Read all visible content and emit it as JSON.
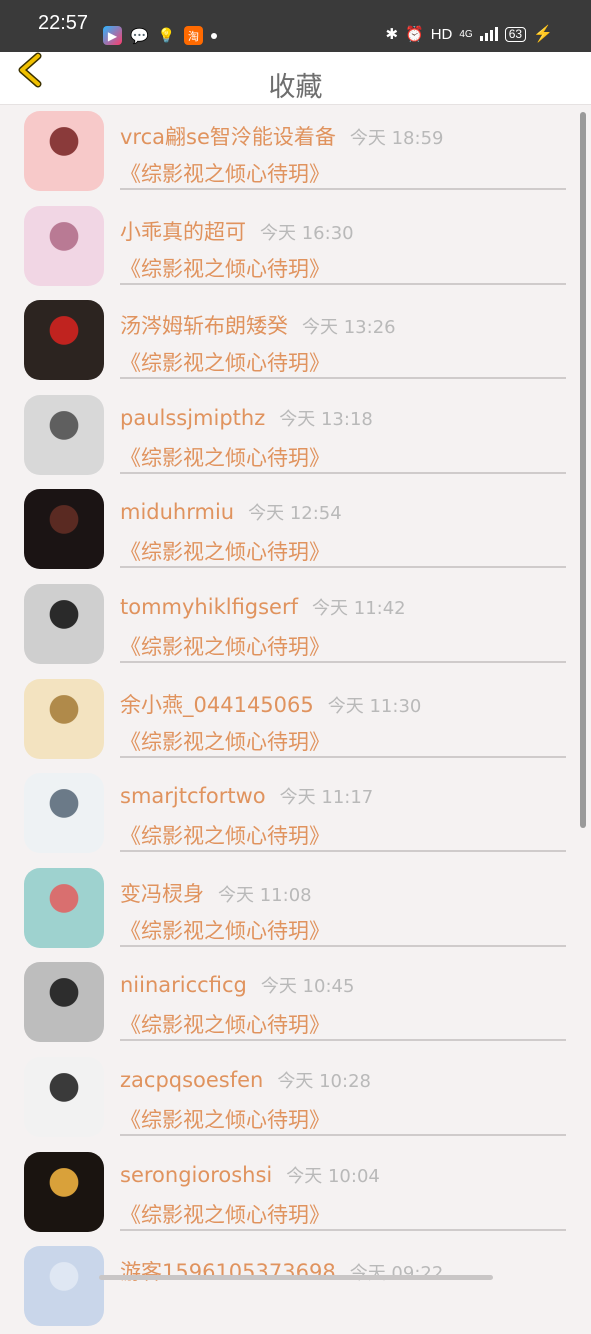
{
  "status_bar": {
    "time": "22:57",
    "app_icons": [
      "youku-icon",
      "wechat-icon",
      "bulb-icon",
      "taobao-icon"
    ],
    "taobao_char": "淘",
    "hd": "HD",
    "network": "4G",
    "battery": "63"
  },
  "header": {
    "title": "收藏"
  },
  "colors": {
    "accent": "#e0935e",
    "time": "#b9b9b9",
    "title": "#6e6e6e",
    "back": "#f0c000"
  },
  "items": [
    {
      "name": "vrca翩se智泠能设着备",
      "time": "今天 18:59",
      "book": "《综影视之倾心待玥》",
      "avatar": [
        "#f7c9c9",
        "#8a3a3a"
      ]
    },
    {
      "name": "小乖真的超可",
      "time": "今天 16:30",
      "book": "《综影视之倾心待玥》",
      "avatar": [
        "#f1d6e4",
        "#b97a94"
      ]
    },
    {
      "name": "汤涔姆斩布朗矮癸",
      "time": "今天 13:26",
      "book": "《综影视之倾心待玥》",
      "avatar": [
        "#2c2420",
        "#c0231f"
      ]
    },
    {
      "name": "paulssjmipthz",
      "time": "今天 13:18",
      "book": "《综影视之倾心待玥》",
      "avatar": [
        "#d8d8d8",
        "#5f5f5f"
      ]
    },
    {
      "name": "miduhrmiu",
      "time": "今天 12:54",
      "book": "《综影视之倾心待玥》",
      "avatar": [
        "#1b1414",
        "#5a2a22"
      ]
    },
    {
      "name": "tommyhiklfigserf",
      "time": "今天 11:42",
      "book": "《综影视之倾心待玥》",
      "avatar": [
        "#cfcfcf",
        "#2a2a2a"
      ]
    },
    {
      "name": "余小燕_044145065",
      "time": "今天 11:30",
      "book": "《综影视之倾心待玥》",
      "avatar": [
        "#f3e3c0",
        "#b08a4a"
      ]
    },
    {
      "name": "smarjtcfortwo",
      "time": "今天 11:17",
      "book": "《综影视之倾心待玥》",
      "avatar": [
        "#eef2f4",
        "#6b7a88"
      ]
    },
    {
      "name": "变冯棂身",
      "time": "今天 11:08",
      "book": "《综影视之倾心待玥》",
      "avatar": [
        "#9ed2cf",
        "#d96f6f"
      ]
    },
    {
      "name": "niinariccficg",
      "time": "今天 10:45",
      "book": "《综影视之倾心待玥》",
      "avatar": [
        "#bdbdbd",
        "#2d2d2d"
      ]
    },
    {
      "name": "zacpqsoesfen",
      "time": "今天 10:28",
      "book": "《综影视之倾心待玥》",
      "avatar": [
        "#f2f2f2",
        "#3a3a3a"
      ]
    },
    {
      "name": "serongioroshsi",
      "time": "今天 10:04",
      "book": "《综影视之倾心待玥》",
      "avatar": [
        "#1a1410",
        "#d9a13a"
      ]
    },
    {
      "name": "游客1596105373698",
      "time": "今天 09:22",
      "book": "",
      "avatar": [
        "#c9d6ea",
        "#dfe7f3"
      ]
    }
  ]
}
